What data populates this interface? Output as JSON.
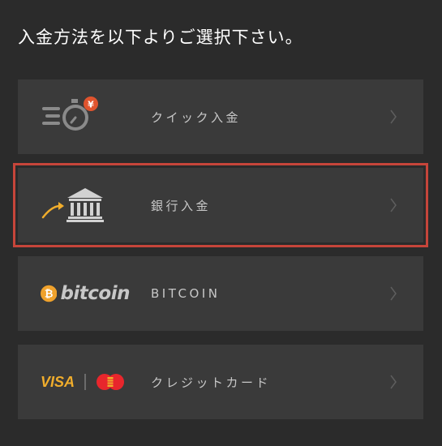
{
  "heading": "入金方法を以下よりご選択下さい。",
  "options": [
    {
      "label": "クイック入金",
      "icon": "quick-deposit-stopwatch-yen-icon"
    },
    {
      "label": "銀行入金",
      "icon": "bank-building-arrow-icon",
      "selected": true
    },
    {
      "label": "BITCOIN",
      "icon": "bitcoin-logo",
      "logo_text": "bitcoin"
    },
    {
      "label": "クレジットカード",
      "icon": "visa-mastercard-logos",
      "logo_text": "VISA"
    }
  ],
  "colors": {
    "background": "#2b2b2b",
    "card": "#3a3a3a",
    "selected_border": "#c6453a",
    "accent_orange": "#f0ad2c",
    "yen_badge": "#e0542e"
  }
}
